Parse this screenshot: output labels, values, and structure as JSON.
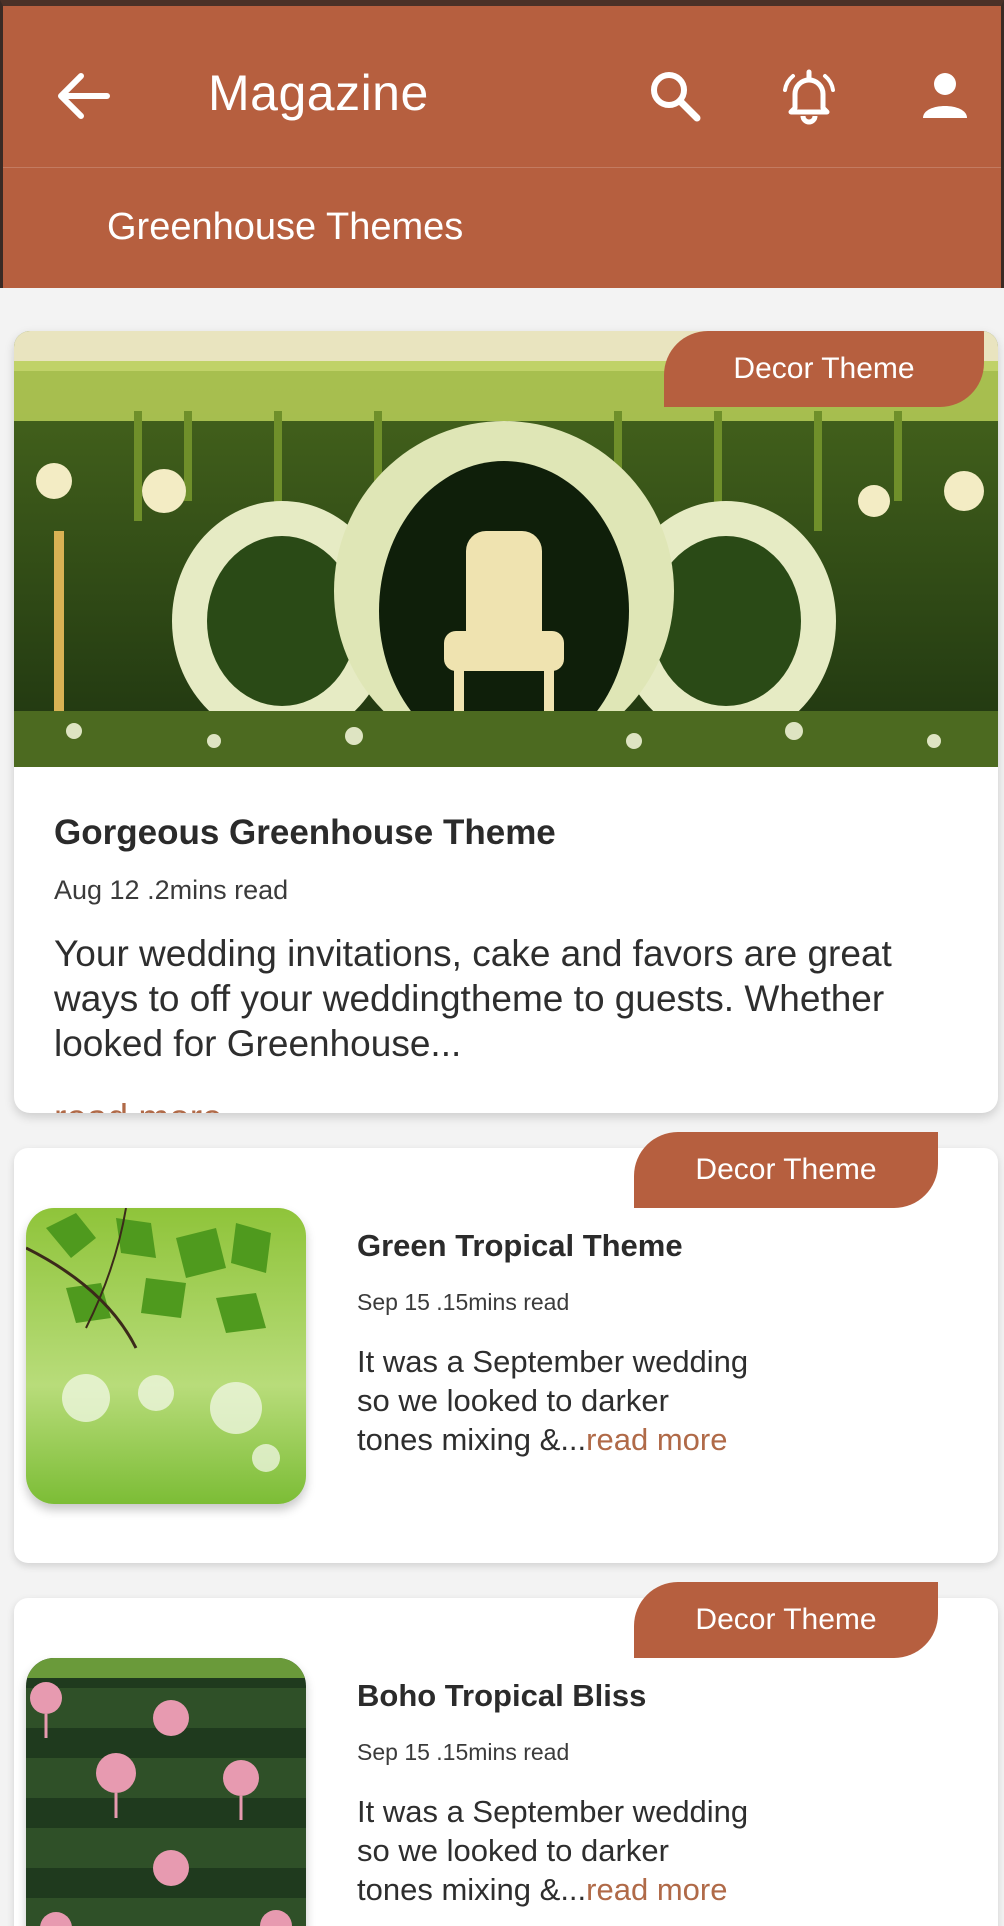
{
  "header": {
    "title": "Magazine",
    "subtitle": "Greenhouse Themes",
    "background_color": "#b65f3f",
    "icons": [
      "back-arrow-icon",
      "search-icon",
      "bell-icon",
      "account-icon"
    ]
  },
  "featured": {
    "tag": "Decor Theme",
    "title": "Gorgeous Greenhouse Theme",
    "meta": "Aug 12 .2mins read",
    "excerpt": "Your wedding invitations, cake and favors are great ways to off your weddingtheme to guests. Whether looked for Greenhouse...",
    "read_more": "read more"
  },
  "articles": [
    {
      "tag": "Decor Theme",
      "title": "Green Tropical Theme",
      "meta": "Sep 15 .15mins read",
      "excerpt_lines": [
        "It was a September wedding",
        "so we looked to darker",
        "tones mixing &..."
      ],
      "read_more": "read more"
    },
    {
      "tag": "Decor Theme",
      "title": "Boho Tropical Bliss",
      "meta": "Sep 15 .15mins read",
      "excerpt_lines": [
        "It was a September wedding",
        "so we looked to darker",
        "tones mixing &..."
      ],
      "read_more": "read more"
    }
  ],
  "colors": {
    "accent": "#b65f3f",
    "read_more": "#b06a48"
  }
}
